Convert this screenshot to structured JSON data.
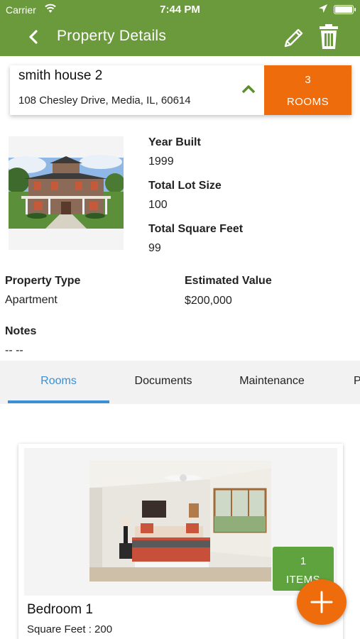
{
  "status_bar": {
    "carrier": "Carrier",
    "time": "7:44 PM"
  },
  "header": {
    "title": "Property Details",
    "icons": [
      "back-arrow-icon",
      "pencil-icon",
      "trash-icon"
    ]
  },
  "property": {
    "name": "smith house 2",
    "address": "108 Chesley Drive, Media, IL, 60614",
    "rooms_count": "3",
    "rooms_label": "ROOMS"
  },
  "details": {
    "year_built_label": "Year Built",
    "year_built": "1999",
    "lot_size_label": "Total Lot Size",
    "lot_size": "100",
    "sqft_label": "Total Square Feet",
    "sqft": "99",
    "property_type_label": "Property Type",
    "property_type": "Apartment",
    "estimated_value_label": "Estimated Value",
    "estimated_value": "$200,000",
    "notes_label": "Notes",
    "notes": "-- --"
  },
  "tabs": [
    {
      "label": "Rooms",
      "active": true
    },
    {
      "label": "Documents",
      "active": false
    },
    {
      "label": "Maintenance",
      "active": false
    },
    {
      "label": "P",
      "active": false
    }
  ],
  "rooms": [
    {
      "name": "Bedroom 1",
      "square_feet": "Square Feet : 200",
      "items_count": "1",
      "items_label": "ITEMS"
    }
  ],
  "colors": {
    "header_green": "#6b9a3c",
    "accent_orange": "#ef6c0c",
    "tab_blue": "#3a8fd6",
    "items_green": "#5fa33e"
  }
}
